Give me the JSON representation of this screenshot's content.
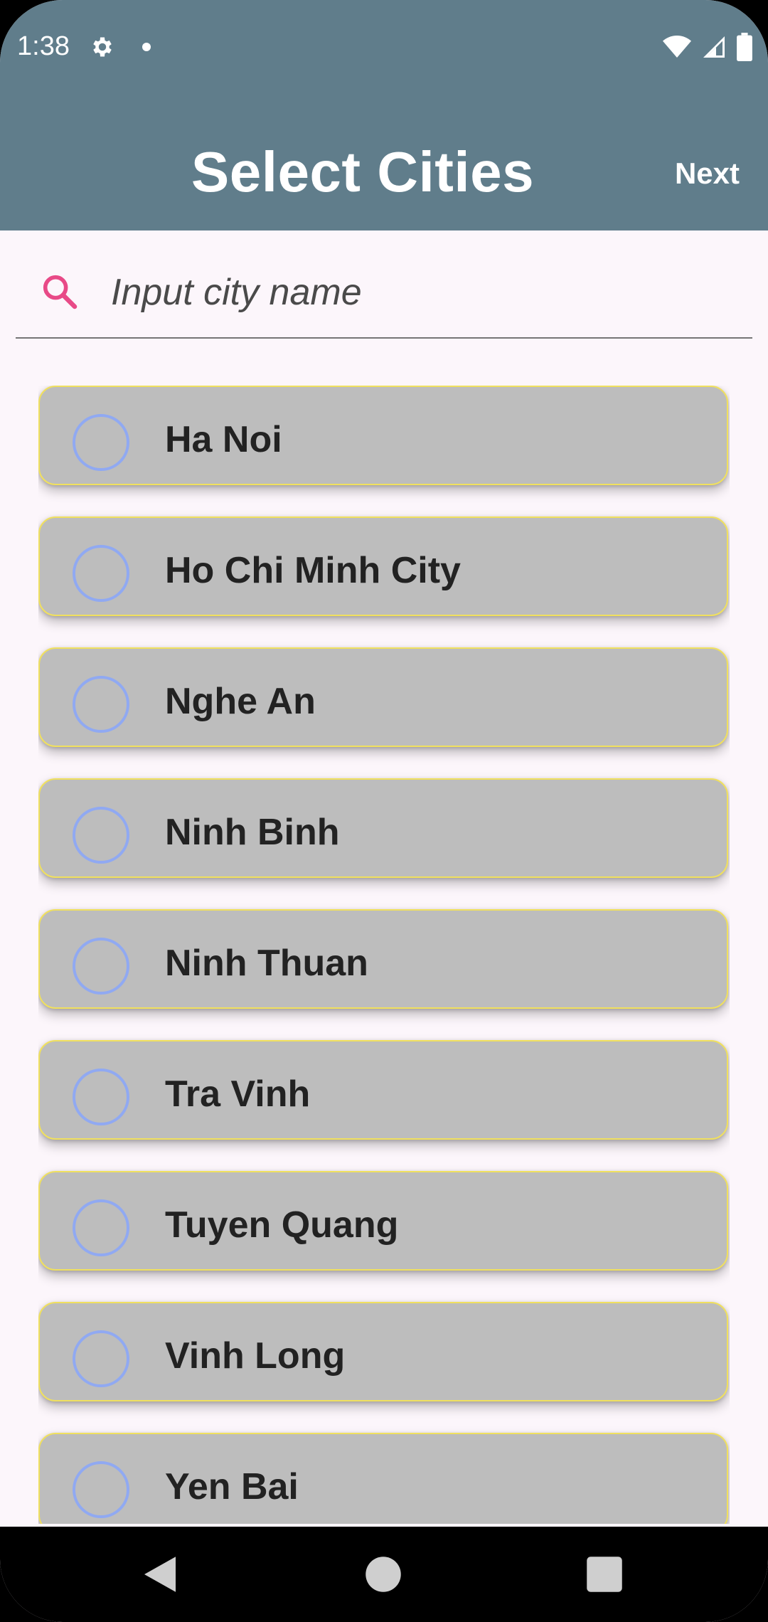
{
  "status_bar": {
    "time": "1:38"
  },
  "header": {
    "title": "Select Cities",
    "next_label": "Next"
  },
  "search": {
    "placeholder": "Input city name"
  },
  "cities": [
    {
      "label": "Ha Noi"
    },
    {
      "label": "Ho Chi Minh City"
    },
    {
      "label": "Nghe An"
    },
    {
      "label": "Ninh Binh"
    },
    {
      "label": "Ninh Thuan"
    },
    {
      "label": "Tra Vinh"
    },
    {
      "label": "Tuyen Quang"
    },
    {
      "label": "Vinh Long"
    },
    {
      "label": "Yen Bai"
    }
  ],
  "icons": {
    "status_settings": "gear-icon",
    "status_wifi": "wifi-icon",
    "status_signal": "signal-icon",
    "status_battery": "battery-icon",
    "search": "search-icon",
    "nav_back": "back-triangle-icon",
    "nav_home": "home-circle-icon",
    "nav_recents": "recents-square-icon"
  },
  "colors": {
    "appbar": "#607d8b",
    "background": "#fcf6fb",
    "card": "#bdbdbd",
    "card_border": "#f0e05e",
    "radio": "#90a9f2",
    "search_icon": "#e84a87"
  }
}
